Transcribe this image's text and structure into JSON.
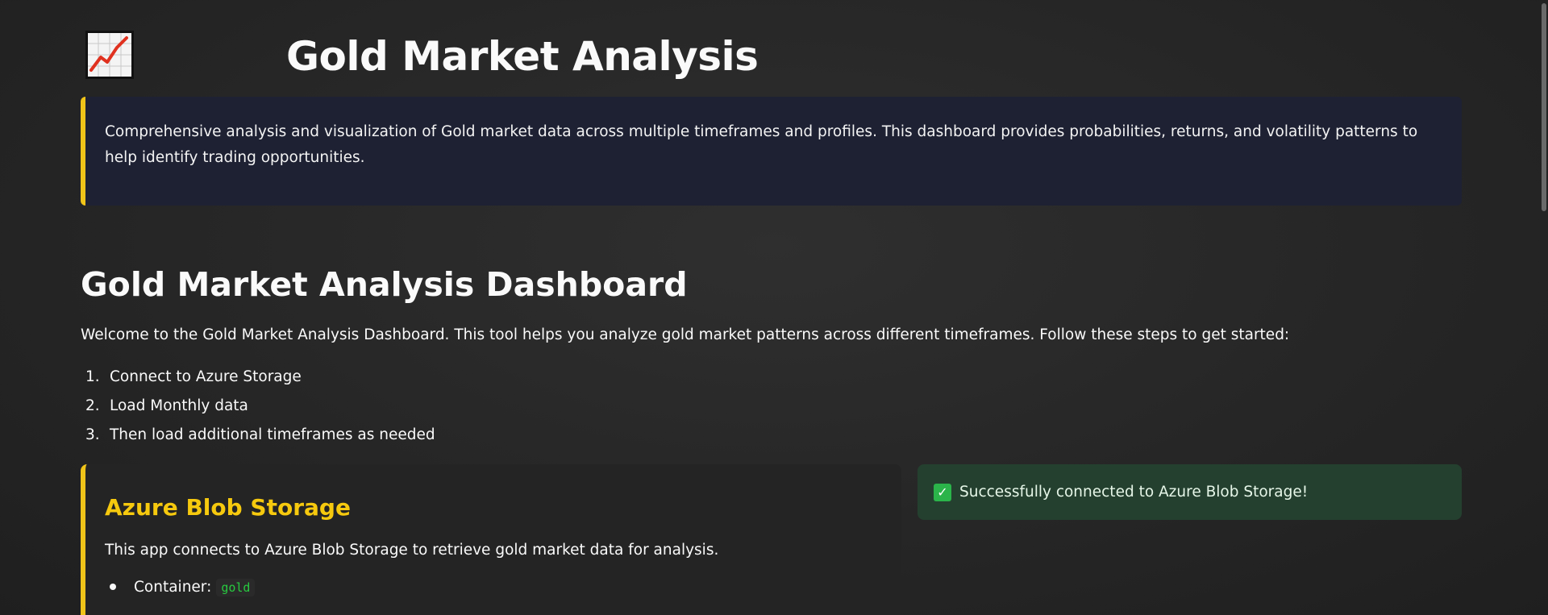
{
  "header": {
    "logo_icon": "chart-increasing-icon",
    "title": "Gold Market Analysis"
  },
  "intro": {
    "text": "Comprehensive analysis and visualization of Gold market data across multiple timeframes and profiles. This dashboard provides probabilities, returns, and volatility patterns to help identify trading opportunities."
  },
  "dashboard": {
    "title": "Gold Market Analysis Dashboard",
    "welcome": "Welcome to the Gold Market Analysis Dashboard. This tool helps you analyze gold market patterns across different timeframes. Follow these steps to get started:",
    "steps": [
      {
        "num": "1.",
        "label": "Connect to Azure Storage"
      },
      {
        "num": "2.",
        "label": "Load Monthly data"
      },
      {
        "num": "3.",
        "label": "Then load additional timeframes as needed"
      }
    ]
  },
  "azure": {
    "title": "Azure Blob Storage",
    "description": "This app connects to Azure Blob Storage to retrieve gold market data for analysis.",
    "container_label": "Container:",
    "container_value": "gold"
  },
  "status": {
    "message": "Successfully connected to Azure Blob Storage!",
    "icon": "check-mark-icon"
  },
  "colors": {
    "accent": "#f0c419",
    "success_bg": "#24402f",
    "intro_bg": "#1e2133"
  }
}
